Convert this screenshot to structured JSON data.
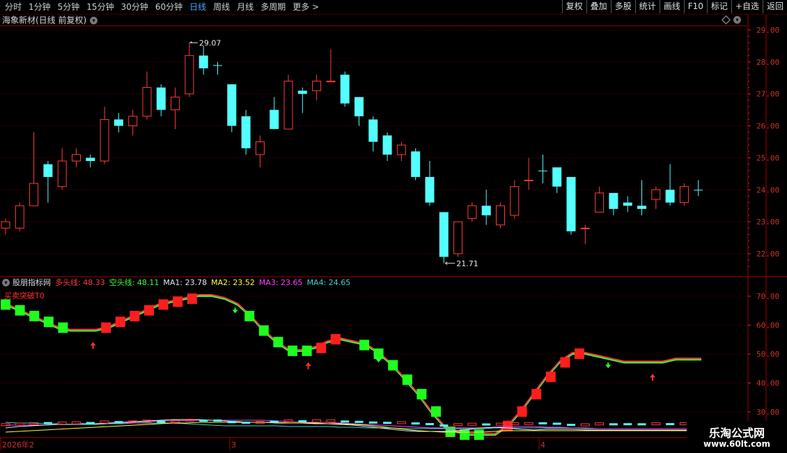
{
  "toolbar": {
    "periods": [
      "分时",
      "1分钟",
      "5分钟",
      "15分钟",
      "30分钟",
      "60分钟",
      "日线",
      "周线",
      "月线",
      "多周期",
      "更多 >"
    ],
    "active": "日线",
    "right_buttons": [
      "复权",
      "叠加",
      "多股",
      "统计",
      "画线",
      "F10",
      "标记",
      "+自选",
      "返回"
    ]
  },
  "kline": {
    "title": "海象新材(日线 前复权)",
    "high_label": "29.07",
    "low_label": "21.71",
    "y_ticks": [
      "29.00",
      "28.00",
      "27.00",
      "26.00",
      "25.00",
      "24.00",
      "23.00",
      "22.00"
    ],
    "up_color": "#ff3c3c",
    "down_color": "#54ffff",
    "candles": [
      [
        22.8,
        23.0,
        22.6,
        23.1,
        "u"
      ],
      [
        22.8,
        23.5,
        22.7,
        23.6,
        "u"
      ],
      [
        23.5,
        24.2,
        23.5,
        25.8,
        "u"
      ],
      [
        24.4,
        24.8,
        23.6,
        24.9,
        "d"
      ],
      [
        24.1,
        24.9,
        24.0,
        25.3,
        "u"
      ],
      [
        24.9,
        25.1,
        24.7,
        25.3,
        "u"
      ],
      [
        25.0,
        24.9,
        24.7,
        25.1,
        "d"
      ],
      [
        24.9,
        26.2,
        24.8,
        26.6,
        "u"
      ],
      [
        26.2,
        26.0,
        25.8,
        26.4,
        "d"
      ],
      [
        26.0,
        26.3,
        25.7,
        26.5,
        "u"
      ],
      [
        26.3,
        27.2,
        26.2,
        27.7,
        "u"
      ],
      [
        27.2,
        26.5,
        26.3,
        27.3,
        "d"
      ],
      [
        26.5,
        26.9,
        25.9,
        27.2,
        "u"
      ],
      [
        27.0,
        28.2,
        26.9,
        28.6,
        "u"
      ],
      [
        28.2,
        27.8,
        27.6,
        28.5,
        "d"
      ],
      [
        27.9,
        27.9,
        27.6,
        28.0,
        "d"
      ],
      [
        27.3,
        26.0,
        25.8,
        27.3,
        "d"
      ],
      [
        26.3,
        25.3,
        25.1,
        26.5,
        "d"
      ],
      [
        25.1,
        25.5,
        24.7,
        25.7,
        "u"
      ],
      [
        25.9,
        26.5,
        25.9,
        26.9,
        "d"
      ],
      [
        25.9,
        27.4,
        25.9,
        27.6,
        "u"
      ],
      [
        27.1,
        27.0,
        26.4,
        27.2,
        "d"
      ],
      [
        27.1,
        27.4,
        26.8,
        27.6,
        "u"
      ],
      [
        27.4,
        27.4,
        27.4,
        28.4,
        "u"
      ],
      [
        27.6,
        26.7,
        26.6,
        27.7,
        "d"
      ],
      [
        26.9,
        26.3,
        26.0,
        26.9,
        "d"
      ],
      [
        26.2,
        25.5,
        25.2,
        26.3,
        "d"
      ],
      [
        25.7,
        25.1,
        24.9,
        25.8,
        "d"
      ],
      [
        25.1,
        25.4,
        24.9,
        25.5,
        "u"
      ],
      [
        25.2,
        24.4,
        24.3,
        25.3,
        "d"
      ],
      [
        24.4,
        23.6,
        23.5,
        24.9,
        "d"
      ],
      [
        23.3,
        21.9,
        21.7,
        23.3,
        "d"
      ],
      [
        22.0,
        23.0,
        21.9,
        23.0,
        "u"
      ],
      [
        23.1,
        23.5,
        23.0,
        23.6,
        "u"
      ],
      [
        23.5,
        23.2,
        22.9,
        24.0,
        "d"
      ],
      [
        22.9,
        23.5,
        22.8,
        23.6,
        "u"
      ],
      [
        23.2,
        24.1,
        23.1,
        24.3,
        "u"
      ],
      [
        24.3,
        24.3,
        24.0,
        25.0,
        "u"
      ],
      [
        24.6,
        24.6,
        24.2,
        25.1,
        "d"
      ],
      [
        24.7,
        24.1,
        23.9,
        24.7,
        "d"
      ],
      [
        24.4,
        22.7,
        22.6,
        24.4,
        "d"
      ],
      [
        22.8,
        22.8,
        22.3,
        22.9,
        "u"
      ],
      [
        23.3,
        23.9,
        23.3,
        24.1,
        "u"
      ],
      [
        23.9,
        23.4,
        23.2,
        23.9,
        "d"
      ],
      [
        23.6,
        23.5,
        23.3,
        23.8,
        "d"
      ],
      [
        23.5,
        23.4,
        23.2,
        24.3,
        "d"
      ],
      [
        23.7,
        24.0,
        23.4,
        24.1,
        "u"
      ],
      [
        24.0,
        23.6,
        23.5,
        24.8,
        "d"
      ],
      [
        23.6,
        24.1,
        23.5,
        24.2,
        "u"
      ],
      [
        24.0,
        24.0,
        23.8,
        24.3,
        "d"
      ]
    ]
  },
  "indicator": {
    "name": "股朋指标网",
    "signal_label": "买卖突破T0",
    "bull_label": "多头线: 48.33",
    "bear_label": "空头线: 48.11",
    "ma1": "MA1: 23.78",
    "ma2": "MA2: 23.52",
    "ma3": "MA3: 23.65",
    "ma4": "MA4: 24.65",
    "y_ticks": [
      "70.00",
      "60.00",
      "50.00",
      "40.00",
      "30.00"
    ],
    "colors": {
      "bull": "#ff3c3c",
      "bear": "#3cff3c",
      "ma1": "#e8e8e8",
      "ma2": "#ffff40",
      "ma3": "#ff40ff",
      "ma4": "#40d0d0"
    },
    "line_values": [
      67,
      65,
      63,
      61,
      59,
      58,
      58,
      58,
      59,
      61,
      63,
      65,
      67,
      68,
      69,
      70,
      70,
      69,
      67,
      63,
      58,
      54,
      51,
      51,
      52,
      54,
      55,
      54,
      53,
      50,
      46,
      41,
      36,
      30,
      25,
      23,
      22,
      22,
      22,
      25,
      30,
      36,
      42,
      47,
      50,
      50,
      49,
      48,
      47,
      47,
      47,
      47,
      48,
      48,
      48
    ],
    "blocks": [
      [
        0,
        "b"
      ],
      [
        1,
        "b"
      ],
      [
        2,
        "b"
      ],
      [
        3,
        "b"
      ],
      [
        4,
        "b"
      ],
      [
        7,
        "r"
      ],
      [
        8,
        "r"
      ],
      [
        9,
        "r"
      ],
      [
        10,
        "r"
      ],
      [
        11,
        "r"
      ],
      [
        12,
        "r"
      ],
      [
        13,
        "r"
      ],
      [
        17,
        "b"
      ],
      [
        18,
        "b"
      ],
      [
        19,
        "b"
      ],
      [
        20,
        "b"
      ],
      [
        21,
        "b"
      ],
      [
        22,
        "r"
      ],
      [
        23,
        "r"
      ],
      [
        25,
        "b"
      ],
      [
        26,
        "b"
      ],
      [
        27,
        "b"
      ],
      [
        28,
        "b"
      ],
      [
        29,
        "b"
      ],
      [
        30,
        "b"
      ],
      [
        31,
        "b"
      ],
      [
        32,
        "b"
      ],
      [
        33,
        "b"
      ],
      [
        35,
        "r"
      ],
      [
        36,
        "r"
      ],
      [
        37,
        "r"
      ],
      [
        38,
        "r"
      ],
      [
        39,
        "r"
      ],
      [
        40,
        "r"
      ]
    ],
    "up_arrows": [
      6,
      21,
      45
    ],
    "down_arrows": [
      16,
      26,
      42
    ]
  },
  "xaxis": {
    "labels": [
      "2026年2",
      "3",
      "4"
    ]
  },
  "watermark": {
    "line1": "乐淘公式网",
    "line2": "www.60lt.com"
  }
}
